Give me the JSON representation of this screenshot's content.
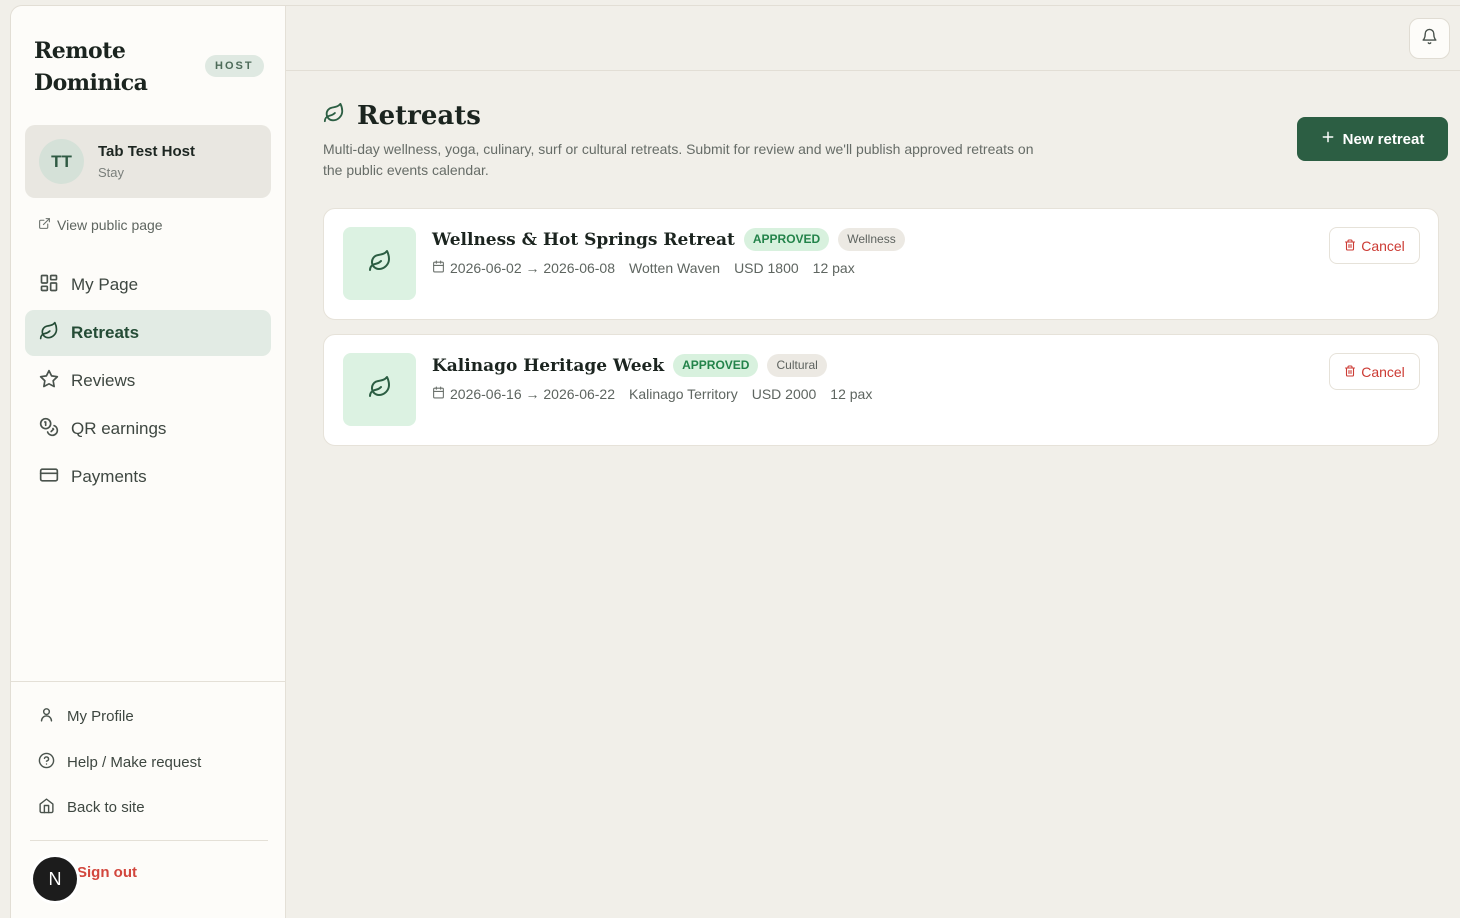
{
  "sidebar": {
    "brand": "Remote Dominica",
    "role_badge": "HOST",
    "user": {
      "initials": "TT",
      "name": "Tab Test Host",
      "role": "Stay"
    },
    "public_link": "View public page",
    "nav": [
      {
        "label": "My Page",
        "icon": "grid-icon"
      },
      {
        "label": "Retreats",
        "icon": "leaf-icon",
        "active": true
      },
      {
        "label": "Reviews",
        "icon": "star-icon"
      },
      {
        "label": "QR earnings",
        "icon": "coins-icon"
      },
      {
        "label": "Payments",
        "icon": "credit-card-icon"
      }
    ],
    "bottom": {
      "profile": "My Profile",
      "help": "Help / Make request",
      "back": "Back to site",
      "signout": "Sign out"
    },
    "fab_label": "N"
  },
  "page": {
    "title": "Retreats",
    "description": "Multi-day wellness, yoga, culinary, surf or cultural retreats. Submit for review and we'll publish approved retreats on the public events calendar.",
    "new_button": "New retreat"
  },
  "retreats": [
    {
      "title": "Wellness & Hot Springs Retreat",
      "status": "APPROVED",
      "category": "Wellness",
      "dates": "2026-06-02 → 2026-06-08",
      "location": "Wotten Waven",
      "price": "USD 1800",
      "capacity": "12 pax",
      "cancel": "Cancel"
    },
    {
      "title": "Kalinago Heritage Week",
      "status": "APPROVED",
      "category": "Cultural",
      "dates": "2026-06-16 → 2026-06-22",
      "location": "Kalinago Territory",
      "price": "USD 2000",
      "capacity": "12 pax",
      "cancel": "Cancel"
    }
  ],
  "colors": {
    "accent": "#2c5e43",
    "approved": "#23834a",
    "danger": "#cc3b34",
    "background": "#f1efe9"
  }
}
